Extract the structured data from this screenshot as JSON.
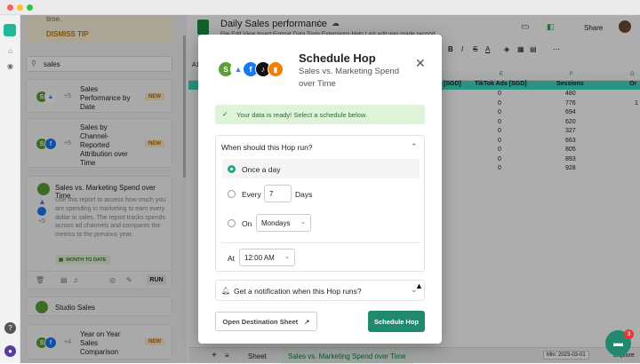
{
  "sidebar": {
    "tip_text": "time.",
    "dismiss_label": "DISMISS TIP",
    "search_value": "sales",
    "items": [
      {
        "title": "Sales Performance by Date",
        "count": "+5",
        "badge": "NEW"
      },
      {
        "title": "Sales by Channel-Reported Attribution over Time",
        "count": "+5",
        "badge": "NEW"
      },
      {
        "title": "Sales vs. Marketing Spend over Time",
        "count": "+5",
        "description": "Use this report to assess how much you are spending in marketing to earn every dollar in sales. The report tracks spends across ad channels and compares the metrics to the previous year.",
        "date_chip": "MONTH TO DATE",
        "run_label": "RUN"
      },
      {
        "title": "Studio Sales"
      },
      {
        "title": "Year on Year Sales Comparison",
        "count": "+4",
        "badge": "NEW"
      }
    ]
  },
  "sheet": {
    "title": "Daily Sales performance",
    "menu_text": "File  Edit  View  Insert  Format  Data  Tools  Extensions  Help  Last edit was made second...",
    "share_label": "Share",
    "cell_ref": "A1",
    "col_headers": [
      "E",
      "F",
      "G"
    ],
    "header_row": [
      "[SGD]",
      "TikTok Ads [SGD]",
      "Sessions",
      "Or"
    ],
    "tiktok": [
      "0",
      "0",
      "0",
      "0",
      "0",
      "0",
      "0",
      "0",
      "0"
    ],
    "sessions": [
      "480",
      "776",
      "694",
      "620",
      "327",
      "663",
      "805",
      "893",
      "928"
    ],
    "extra_value": "1",
    "tabs": [
      "Sheet",
      "Sales vs. Marketing Spend over Time"
    ],
    "date_filter": "Min: 2023-03-01",
    "explore_label": "Explore",
    "chat_count": "3"
  },
  "modal": {
    "title": "Schedule Hop",
    "subtitle": "Sales vs. Marketing Spend over Time",
    "success_msg": "Your data is ready! Select a schedule below.",
    "question": "When should this Hop run?",
    "option_once": "Once a day",
    "option_every": "Every",
    "every_value": "7",
    "days_label": "Days",
    "option_on": "On",
    "weekday": "Mondays",
    "at_label": "At",
    "time": "12:00 AM",
    "notify_label": "Get a notification when this Hop runs?",
    "open_dest_label": "Open Destination Sheet",
    "schedule_label": "Schedule Hop"
  },
  "colors": {
    "accent": "#1f8a70",
    "success_bg": "#dff3d8",
    "tip_bg": "#fdf3dc"
  }
}
